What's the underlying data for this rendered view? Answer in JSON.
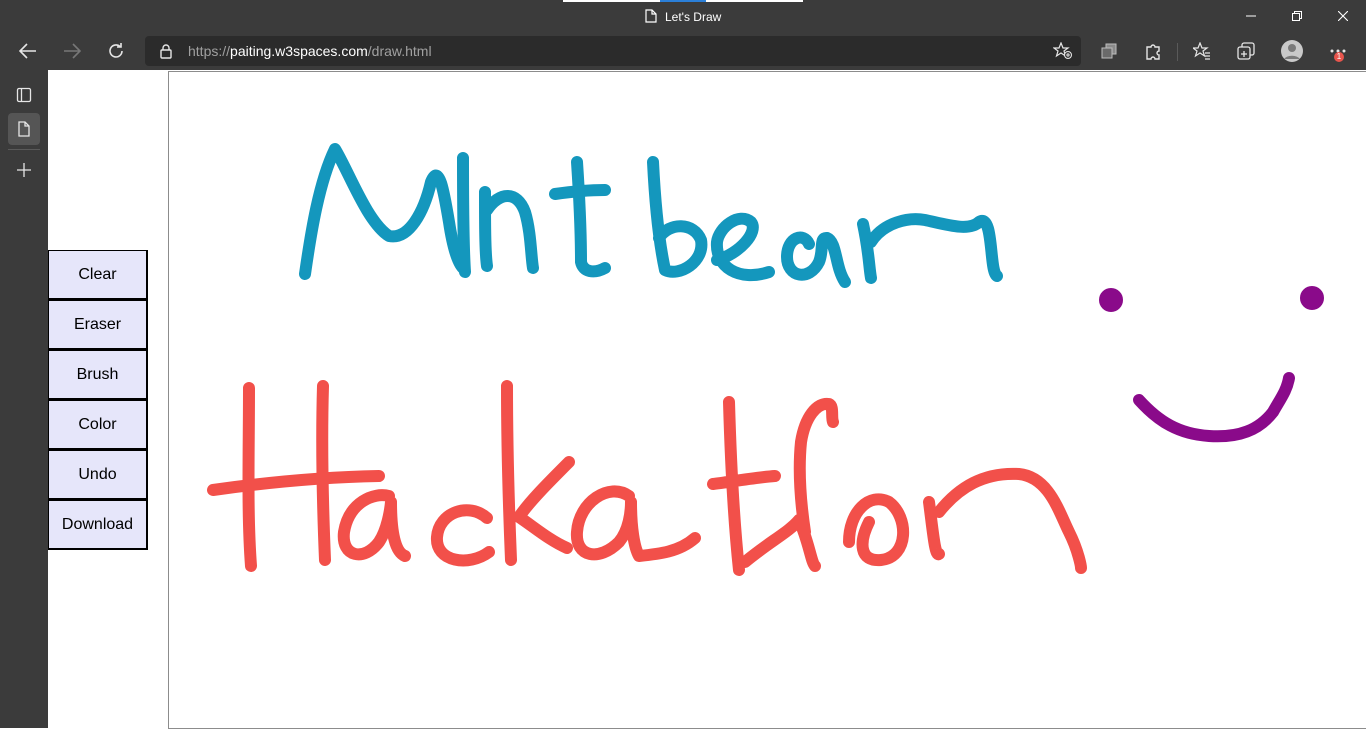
{
  "window": {
    "title": "Let's Draw",
    "minimize_glyph": "—",
    "maximize_glyph": "❐",
    "close_glyph": "✕"
  },
  "toolbar": {
    "url_scheme": "https://",
    "url_host": "paiting.w3spaces.com",
    "url_path": "/draw.html",
    "notification_count": "1"
  },
  "app": {
    "buttons": [
      "Clear",
      "Eraser",
      "Brush",
      "Color",
      "Undo",
      "Download"
    ]
  },
  "drawing": {
    "colors": {
      "mintbean_stroke": "#1497bd",
      "hackathon_stroke": "#f2504a",
      "smiley_stroke": "#8a0a8a"
    },
    "content_description": "handwritten Mintbean, Hackathon and smiley"
  },
  "colors": {
    "chrome": "#3b3b3b",
    "button_bg": "#e6e6fa"
  }
}
